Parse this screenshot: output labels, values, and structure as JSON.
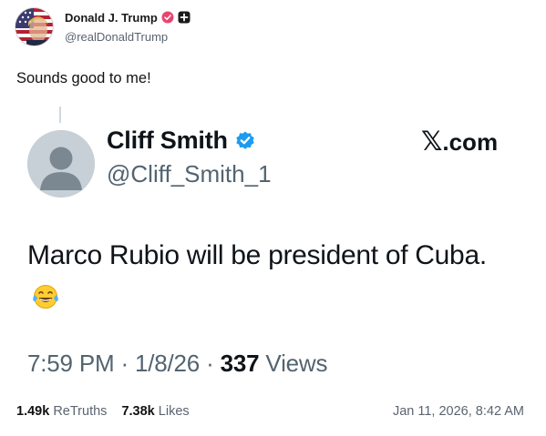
{
  "post": {
    "author": {
      "display_name": "Donald J. Trump",
      "handle": "@realDonaldTrump",
      "verified_badge_icon": "verified-badge-icon",
      "plus_badge_icon": "plus-badge-icon"
    },
    "text": "Sounds good to me!",
    "stats": {
      "retruths_count": "1.49k",
      "retruths_label": "ReTruths",
      "likes_count": "7.38k",
      "likes_label": "Likes"
    },
    "timestamp": "Jan 11, 2026, 8:42 AM"
  },
  "quoted_post": {
    "author": {
      "display_name": "Cliff Smith",
      "handle": "@Cliff_Smith_1",
      "verified_icon": "blue-verified-icon",
      "avatar_icon": "default-profile-icon"
    },
    "site": {
      "logo_glyph": "𝕏",
      "suffix": ".com"
    },
    "text": "Marco Rubio will be president of Cuba.",
    "emoji_icon": "tears-of-joy-emoji",
    "meta": {
      "time": "7:59 PM",
      "separator": "·",
      "date": "1/8/26",
      "views_count": "337",
      "views_label": "Views"
    }
  },
  "colors": {
    "verified_blue": "#1d9bf0",
    "truth_badge_pink": "#e8456e",
    "handle_gray": "#536471"
  }
}
